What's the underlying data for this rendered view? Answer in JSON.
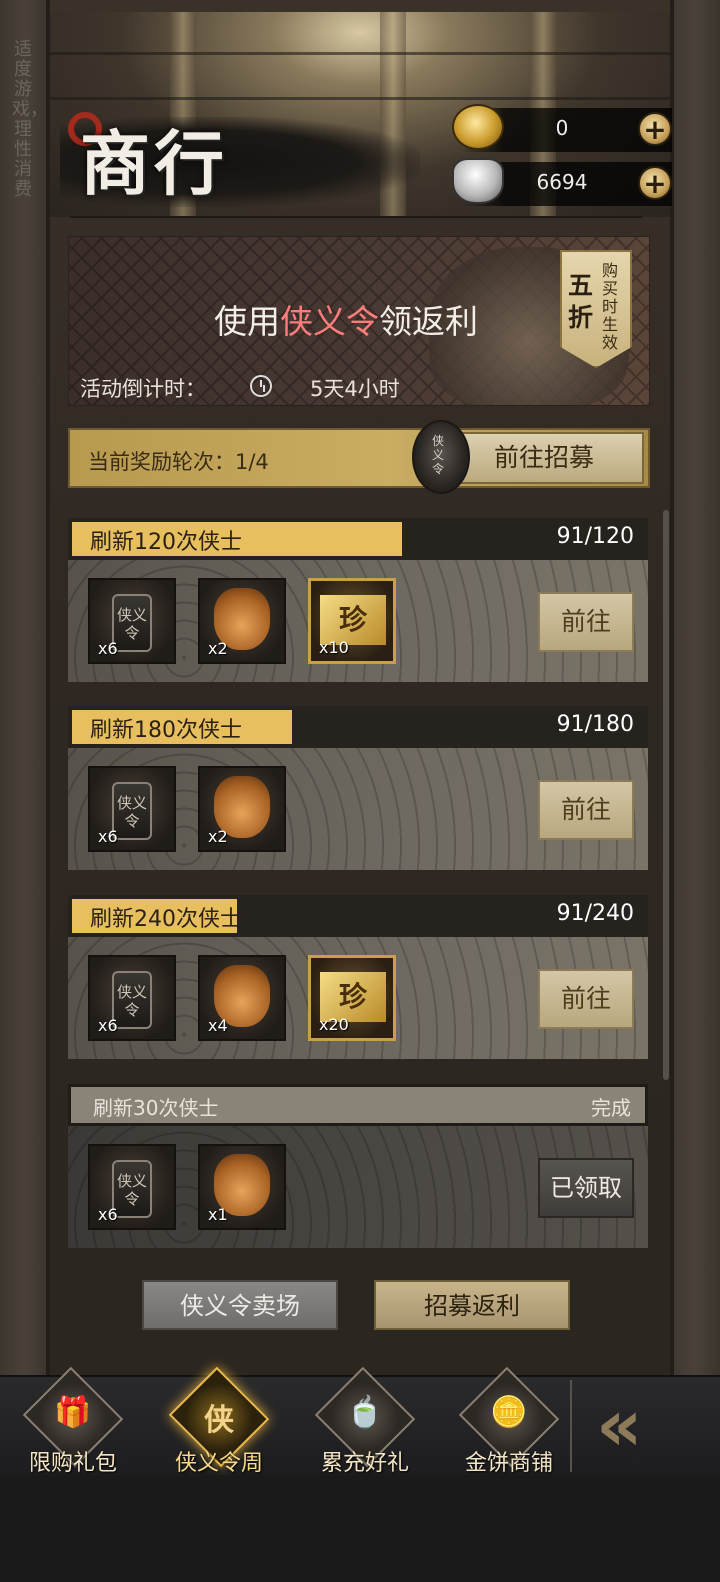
{
  "side_notice": "适度游戏，理性消费",
  "header": {
    "title": "商行",
    "currencies": [
      {
        "name": "gold-ingot",
        "icon": "gold-coin-icon",
        "value": "0"
      },
      {
        "name": "silver-ingot",
        "icon": "silver-ingot-icon",
        "value": "6694"
      }
    ],
    "plus_symbol": "+"
  },
  "banner": {
    "title_before": "使用",
    "title_highlight": "侠义令",
    "title_after": "领返利",
    "discount_big": "五折",
    "discount_small": "购买时生效",
    "countdown_label": "活动倒计时：",
    "countdown_value": "5天4小时"
  },
  "round": {
    "text": "当前奖励轮次：1/4",
    "recruit_button": "前往招募",
    "token_icon": "xiayi-token-icon"
  },
  "tasks": [
    {
      "title": "刷新120次侠士",
      "progress": "91/120",
      "fill": 0.758,
      "items": [
        {
          "icon": "xiayi-token-icon",
          "count": "x6"
        },
        {
          "icon": "coin-bag-icon",
          "count": "x2"
        },
        {
          "icon": "rare-ticket-icon",
          "count": "x10",
          "label": "珍"
        }
      ],
      "button": "前往"
    },
    {
      "title": "刷新180次侠士",
      "progress": "91/180",
      "fill": 0.506,
      "items": [
        {
          "icon": "xiayi-token-icon",
          "count": "x6"
        },
        {
          "icon": "coin-bag-icon",
          "count": "x2"
        }
      ],
      "button": "前往"
    },
    {
      "title": "刷新240次侠士",
      "progress": "91/240",
      "fill": 0.379,
      "items": [
        {
          "icon": "xiayi-token-icon",
          "count": "x6"
        },
        {
          "icon": "coin-bag-icon",
          "count": "x4"
        },
        {
          "icon": "rare-ticket-icon",
          "count": "x20",
          "label": "珍"
        }
      ],
      "button": "前往"
    },
    {
      "title": "刷新30次侠士",
      "progress": "完成",
      "fill": 1,
      "items": [
        {
          "icon": "xiayi-token-icon",
          "count": "x6"
        },
        {
          "icon": "coin-bag-icon",
          "count": "x1"
        }
      ],
      "button": "已领取"
    }
  ],
  "token_text": "侠义令",
  "bottom_buttons": {
    "market": "侠义令卖场",
    "rebate": "招募返利"
  },
  "nav": [
    {
      "label": "限购礼包",
      "icon": "gift-box-icon",
      "glyph": "🎁"
    },
    {
      "label": "侠义令周",
      "icon": "xiayi-week-icon",
      "glyph": "侠",
      "active": true
    },
    {
      "label": "累充好礼",
      "icon": "tea-set-icon",
      "glyph": "🍵"
    },
    {
      "label": "金饼商铺",
      "icon": "gold-cakes-icon",
      "glyph": "🪙"
    }
  ],
  "back_label": "«",
  "colors": {
    "accent_gold": "#e8bf5f",
    "highlight_red": "#ff7d7a",
    "panel_dark": "#26221e"
  }
}
